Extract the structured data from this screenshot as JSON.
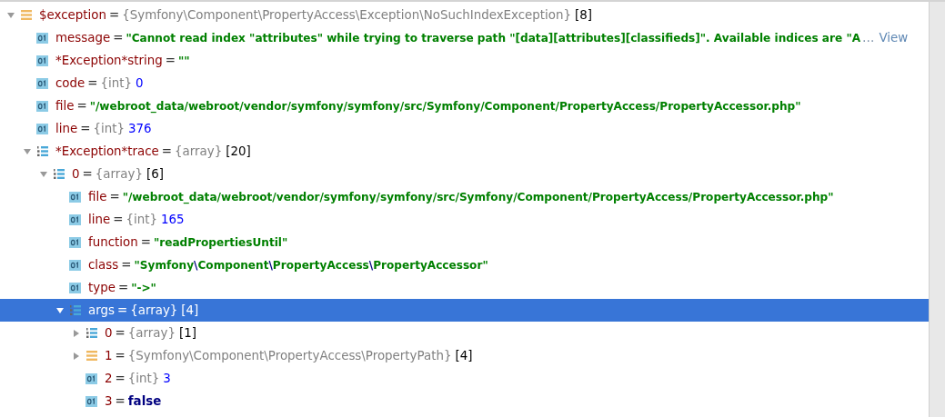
{
  "tree": [
    {
      "name": "$exception",
      "sep": "=",
      "kind": "object",
      "type": "{Symfony\\Component\\PropertyAccess\\Exception\\NoSuchIndexException}",
      "count": "[8]",
      "expanded": true,
      "selected": false,
      "children": [
        {
          "name": "message",
          "sep": "=",
          "kind": "scalar",
          "value": {
            "text": "\"Cannot read index \"attributes\" while trying to traverse path \"[data][attributes][classifieds]\". Available indices are \"A",
            "kind": "string"
          },
          "ellipsis": "…",
          "link": "View",
          "selected": false
        },
        {
          "name": "*Exception*string",
          "sep": "=",
          "kind": "scalar",
          "value": {
            "text": "\"\"",
            "kind": "string"
          },
          "selected": false
        },
        {
          "name": "code",
          "sep": "=",
          "kind": "scalar",
          "type": "{int}",
          "value": {
            "text": "0",
            "kind": "number"
          },
          "selected": false
        },
        {
          "name": "file",
          "sep": "=",
          "kind": "scalar",
          "value": {
            "text": "\"/webroot_data/webroot/vendor/symfony/symfony/src/Symfony/Component/PropertyAccess/PropertyAccessor.php\"",
            "kind": "string"
          },
          "selected": false
        },
        {
          "name": "line",
          "sep": "=",
          "kind": "scalar",
          "type": "{int}",
          "value": {
            "text": "376",
            "kind": "number"
          },
          "selected": false
        },
        {
          "name": "*Exception*trace",
          "sep": "=",
          "kind": "array",
          "type": "{array}",
          "count": "[20]",
          "expanded": true,
          "selected": false,
          "children": [
            {
              "name": "0",
              "sep": "=",
              "kind": "array",
              "type": "{array}",
              "count": "[6]",
              "expanded": true,
              "selected": false,
              "children": [
                {
                  "name": "file",
                  "sep": "=",
                  "kind": "scalar",
                  "value": {
                    "text": "\"/webroot_data/webroot/vendor/symfony/symfony/src/Symfony/Component/PropertyAccess/PropertyAccessor.php\"",
                    "kind": "string"
                  },
                  "selected": false
                },
                {
                  "name": "line",
                  "sep": "=",
                  "kind": "scalar",
                  "type": "{int}",
                  "value": {
                    "text": "165",
                    "kind": "number"
                  },
                  "selected": false
                },
                {
                  "name": "function",
                  "sep": "=",
                  "kind": "scalar",
                  "value": {
                    "text": "\"readPropertiesUntil\"",
                    "kind": "string"
                  },
                  "selected": false
                },
                {
                  "name": "class",
                  "sep": "=",
                  "kind": "scalar",
                  "value": {
                    "text": "\"Symfony\\Component\\PropertyAccess\\PropertyAccessor\"",
                    "kind": "string"
                  },
                  "selected": false
                },
                {
                  "name": "type",
                  "sep": "=",
                  "kind": "scalar",
                  "value": {
                    "text": "\"->\"",
                    "kind": "string"
                  },
                  "selected": false
                },
                {
                  "name": "args",
                  "sep": "=",
                  "kind": "array",
                  "type": "{array}",
                  "count": "[4]",
                  "expanded": true,
                  "selected": true,
                  "children": [
                    {
                      "name": "0",
                      "sep": "=",
                      "kind": "array",
                      "type": "{array}",
                      "count": "[1]",
                      "expanded": false,
                      "selected": false
                    },
                    {
                      "name": "1",
                      "sep": "=",
                      "kind": "object",
                      "type": "{Symfony\\Component\\PropertyAccess\\PropertyPath}",
                      "count": "[4]",
                      "expanded": false,
                      "selected": false
                    },
                    {
                      "name": "2",
                      "sep": "=",
                      "kind": "scalar",
                      "type": "{int}",
                      "value": {
                        "text": "3",
                        "kind": "number"
                      },
                      "selected": false
                    },
                    {
                      "name": "3",
                      "sep": "=",
                      "kind": "scalar",
                      "value": {
                        "text": "false",
                        "kind": "bool"
                      },
                      "selected": false
                    }
                  ]
                }
              ]
            }
          ]
        }
      ]
    }
  ]
}
